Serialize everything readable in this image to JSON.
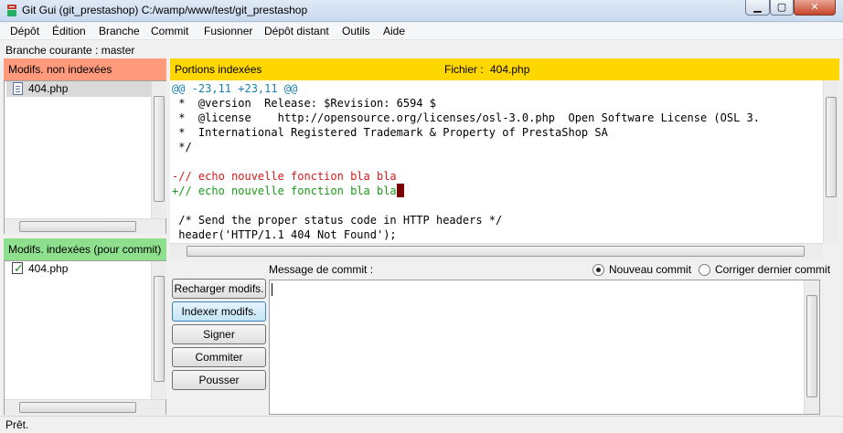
{
  "window": {
    "title": "Git Gui (git_prestashop) C:/wamp/www/test/git_prestashop",
    "min_glyph": "▁",
    "max_glyph": "▢",
    "close_glyph": "✕"
  },
  "menu": [
    "Dépôt",
    "Édition",
    "Branche",
    "Commit",
    "Fusionner",
    "Dépôt distant",
    "Outils",
    "Aide"
  ],
  "branch": {
    "text": "Branche courante : master"
  },
  "unstaged": {
    "header": "Modifs. non indexées",
    "files": [
      "404.php"
    ]
  },
  "staged": {
    "header": "Modifs. indexées (pour commit)",
    "files": [
      "404.php"
    ]
  },
  "diff": {
    "header": "Portions indexées",
    "file_label": "Fichier :",
    "file_name": "404.php",
    "lines": [
      "@@ -23,11 +23,11 @@",
      " *  @version  Release: $Revision: 6594 $",
      " *  @license    http://opensource.org/licenses/osl-3.0.php  Open Software License (OSL 3.",
      " *  International Registered Trademark & Property of PrestaShop SA",
      " */",
      "",
      "-// echo nouvelle fonction bla bla",
      "+// echo nouvelle fonction bla bla",
      "",
      " /* Send the proper status code in HTTP headers */",
      " header('HTTP/1.1 404 Not Found');"
    ]
  },
  "commit": {
    "message_label": "Message de commit :",
    "new_commit_label": "Nouveau commit",
    "amend_label": "Corriger dernier commit",
    "buttons": {
      "rescan": "Recharger modifs.",
      "stage": "Indexer modifs.",
      "sign": "Signer",
      "commit": "Commiter",
      "push": "Pousser"
    }
  },
  "status": {
    "text": "Prêt."
  },
  "colors": {
    "unstaged_header": "#ff9b7c",
    "staged_header": "#8ee08e",
    "diff_header": "#ffd700",
    "hunk": "#1a7eb0",
    "deleted": "#d41a1a",
    "added": "#1a9a1a"
  }
}
